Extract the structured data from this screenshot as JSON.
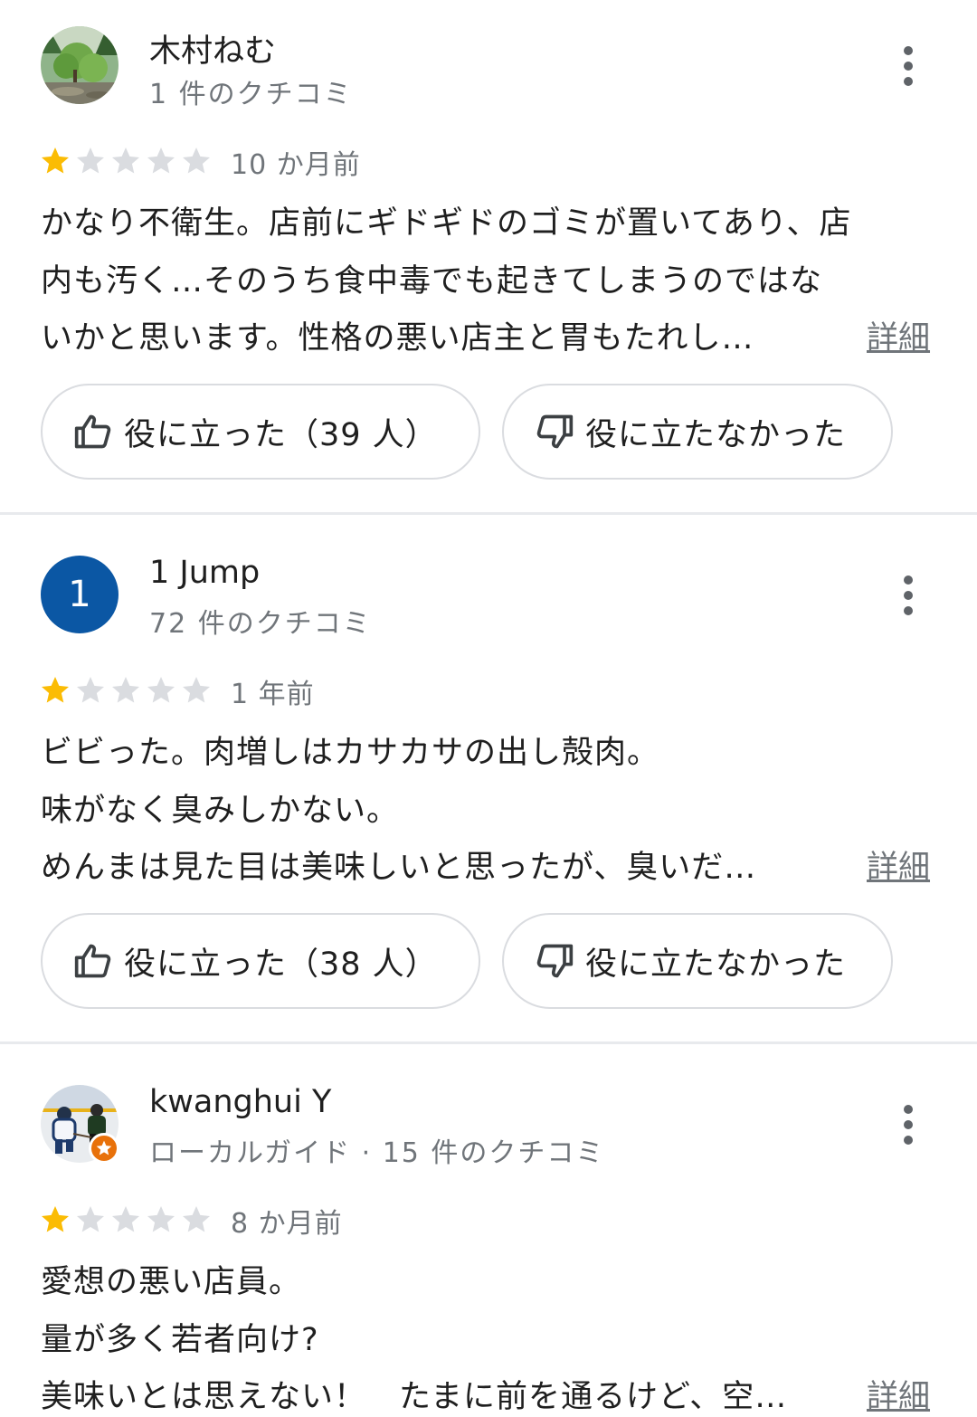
{
  "reviews": [
    {
      "author": "木村ねむ",
      "meta": "1 件のクチコミ",
      "rating": 1,
      "time": "10 か月前",
      "lines": [
        "かなり不衛生。店前にギドギドのゴミが置いてあり、店",
        "内も汚く…そのうち食中毒でも起きてしまうのではな",
        "いかと思います。性格の悪い店主と胃もたれし…"
      ],
      "more_label": "詳細",
      "helpful_label": "役に立った（39 人）",
      "unhelpful_label": "役に立たなかった",
      "avatar_icon": "forest-photo-avatar"
    },
    {
      "author": "1 Jump",
      "meta": "72 件のクチコミ",
      "rating": 1,
      "time": "1 年前",
      "avatar_letter": "1",
      "lines": [
        "ビビった。肉増しはカサカサの出し殻肉。",
        "味がなく臭みしかない。",
        "めんまは見た目は美味しいと思ったが、臭いだ…"
      ],
      "more_label": "詳細",
      "helpful_label": "役に立った（38 人）",
      "unhelpful_label": "役に立たなかった"
    },
    {
      "author": "kwanghui Y",
      "meta": "ローカルガイド · 15 件のクチコミ",
      "rating": 1,
      "time": "8 か月前",
      "lines": [
        "愛想の悪い店員。",
        "量が多く若者向け?",
        "美味いとは思えない！　たまに前を通るけど、空…"
      ],
      "more_label": "詳細",
      "avatar_icon": "hockey-photo-avatar",
      "badge_icon": "local-guide-star-icon"
    }
  ],
  "colors": {
    "star_filled": "#fbbc04",
    "star_empty": "#dadce0",
    "avatar_letter_bg": "#0b57a4",
    "local_guide_badge": "#e8710a"
  }
}
